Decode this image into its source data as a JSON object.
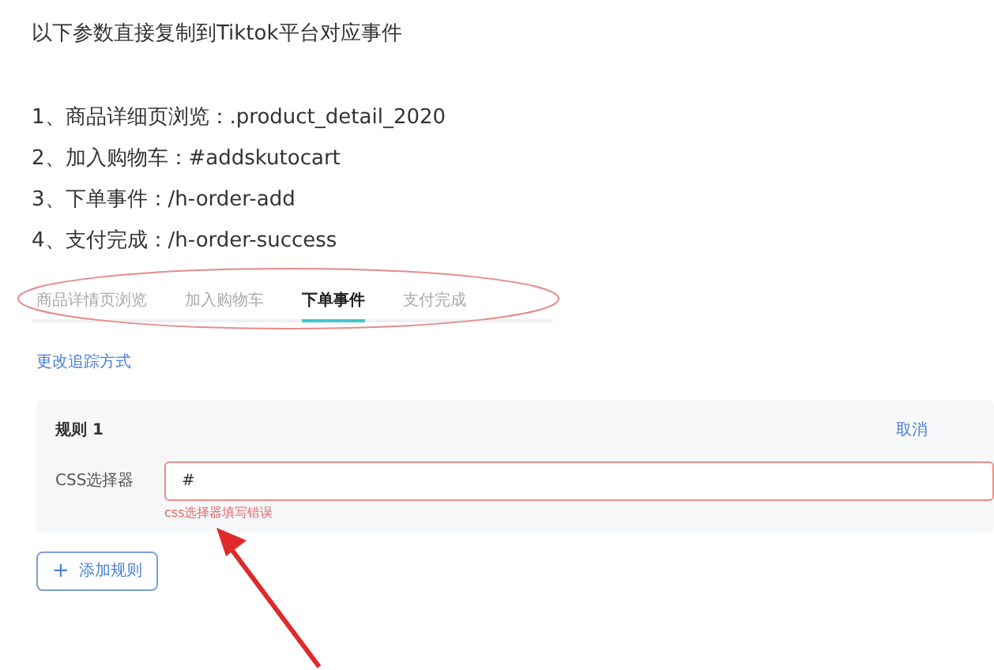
{
  "intro": "以下参数直接复制到Tiktok平台对应事件",
  "list": [
    "1、商品详细页浏览：.product_detail_2020",
    "2、加入购物车：#addskutocart",
    "3、下单事件：/h-order-add",
    "4、支付完成：/h-order-success"
  ],
  "screenshot": {
    "tabs": [
      {
        "label": "商品详情页浏览",
        "selected": false
      },
      {
        "label": "加入购物车",
        "selected": false
      },
      {
        "label": "下单事件",
        "selected": true
      },
      {
        "label": "支付完成",
        "selected": false
      }
    ],
    "change_link": "更改追踪方式",
    "rule": {
      "title": "规则 1",
      "cancel": "取消",
      "field_label": "CSS选择器",
      "value": "#",
      "error": "css选择器填写错误"
    },
    "add_button": {
      "icon": "+",
      "label": "添加规则"
    }
  }
}
